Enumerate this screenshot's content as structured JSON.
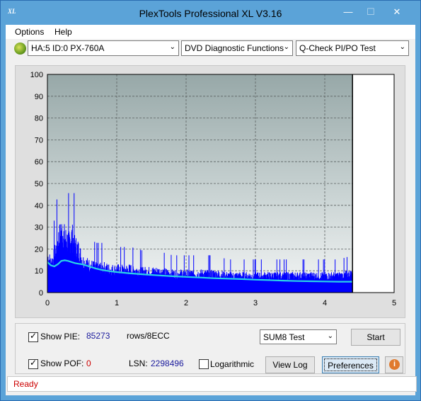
{
  "window": {
    "title": "PlexTools Professional XL V3.16",
    "icon_label": "XL",
    "min_glyph": "—",
    "max_glyph": "☐",
    "close_glyph": "✕"
  },
  "menu": {
    "items": [
      "Options",
      "Help"
    ]
  },
  "toolbar": {
    "drive": "HA:5 ID:0  PX-760A",
    "function": "DVD Diagnostic Functions",
    "test": "Q-Check PI/PO Test",
    "arrow": "⌄"
  },
  "chart_data": {
    "type": "area",
    "x_ticks": [
      "0",
      "1",
      "2",
      "3",
      "4",
      "5"
    ],
    "y_ticks": [
      "0",
      "10",
      "20",
      "30",
      "40",
      "50",
      "60",
      "70",
      "80",
      "90",
      "100"
    ],
    "xlim": [
      0,
      5
    ],
    "ylim": [
      0,
      100
    ],
    "grid": true,
    "end_marker_x": 4.4,
    "series": [
      {
        "type": "bar-density",
        "color": "#0000ff",
        "x": [
          0.0,
          0.05,
          0.1,
          0.15,
          0.2,
          0.25,
          0.3,
          0.35,
          0.4,
          0.45,
          0.5,
          0.6,
          0.7,
          0.8,
          0.9,
          1.0,
          1.2,
          1.4,
          1.6,
          1.8,
          2.0,
          2.2,
          2.4,
          2.6,
          2.8,
          3.0,
          3.2,
          3.4,
          3.6,
          3.8,
          4.0,
          4.2,
          4.4
        ],
        "y": [
          17,
          14,
          18,
          25,
          29,
          26,
          24,
          27,
          22,
          20,
          15,
          13,
          12,
          12,
          11,
          11,
          11,
          10,
          10,
          9,
          9,
          9,
          9,
          8,
          8,
          8,
          8,
          8,
          8,
          8,
          8,
          8,
          9
        ]
      },
      {
        "type": "line",
        "color": "#2ad3e6",
        "x": [
          0.0,
          0.05,
          0.1,
          0.15,
          0.2,
          0.25,
          0.3,
          0.35,
          0.4,
          0.45,
          0.5,
          0.6,
          0.7,
          0.8,
          0.9,
          1.0,
          1.2,
          1.4,
          1.6,
          1.8,
          2.0,
          2.2,
          2.4,
          2.6,
          2.8,
          3.0,
          3.2,
          3.4,
          3.6,
          3.8,
          4.0,
          4.2,
          4.4
        ],
        "y": [
          14,
          12.5,
          12,
          13,
          14.5,
          14.8,
          14.5,
          14,
          13.5,
          13.2,
          13,
          12,
          11,
          10.3,
          9.8,
          9.4,
          8.8,
          8.3,
          7.9,
          7.5,
          7.2,
          6.9,
          6.6,
          6.4,
          6.2,
          5.9,
          5.7,
          5.5,
          5.3,
          5.2,
          5.1,
          5.0,
          5.0
        ]
      }
    ]
  },
  "options": {
    "show_pie_label": "Show PIE:",
    "pie_value": "85273",
    "pie_unit": "rows/8ECC",
    "show_poe_label": "Show POF:",
    "poe_value": "0",
    "lsn_label": "LSN:",
    "lsn_value": "2298496",
    "log_label": "Logarithmic",
    "sum_select": "SUM8 Test",
    "start_label": "Start",
    "viewlog_label": "View Log",
    "prefs_label": "Preferences",
    "info_glyph": "i",
    "check_glyph": "✓"
  },
  "status": {
    "text": "Ready"
  }
}
